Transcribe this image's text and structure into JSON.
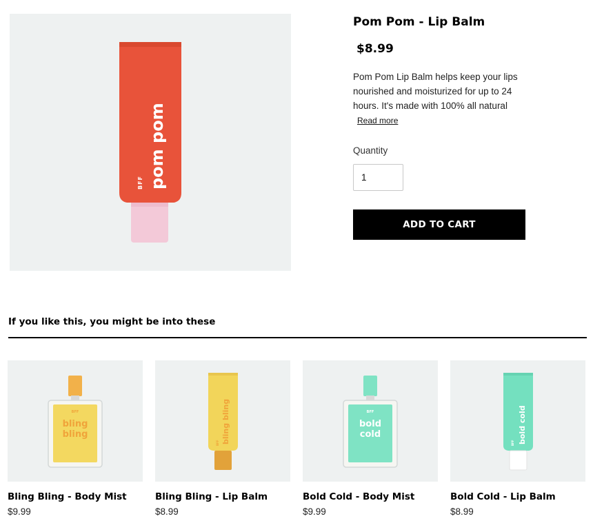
{
  "product": {
    "title": "Pom Pom - Lip Balm",
    "price": "$8.99",
    "description": "Pom Pom Lip Balm helps keep your lips nourished and moisturized for up to 24 hours. It's made with 100% all natural",
    "read_more": "Read more",
    "quantity_label": "Quantity",
    "quantity_value": "1",
    "add_to_cart": "ADD TO CART",
    "image": {
      "tube_text": "pom pom",
      "brand_text": "BFF",
      "tube_color": "#e8533a",
      "cap_color": "#f3c9d8",
      "background": "#eef1f1"
    }
  },
  "related": {
    "heading": "If you like this, you might be into these",
    "items": [
      {
        "name": "Bling Bling - Body Mist",
        "price": "$9.99",
        "kind": "bottle",
        "label": "bling bling",
        "brand": "BFF",
        "color": "#f3d860",
        "cap": "#f2b14a",
        "text_color": "#f0a43a"
      },
      {
        "name": "Bling Bling - Lip Balm",
        "price": "$8.99",
        "kind": "tube",
        "label": "bling bling",
        "brand": "BFF",
        "color": "#f2d55a",
        "cap": "#e2a23a",
        "text_color": "#f0a43a"
      },
      {
        "name": "Bold Cold - Body Mist",
        "price": "$9.99",
        "kind": "bottle",
        "label": "bold cold",
        "brand": "BFF",
        "color": "#7fe3c4",
        "cap": "#7fe3c4",
        "text_color": "#ffffff"
      },
      {
        "name": "Bold Cold - Lip Balm",
        "price": "$8.99",
        "kind": "tube",
        "label": "bold cold",
        "brand": "BFF",
        "color": "#74e0bf",
        "cap": "#ffffff",
        "text_color": "#ffffff"
      }
    ]
  }
}
